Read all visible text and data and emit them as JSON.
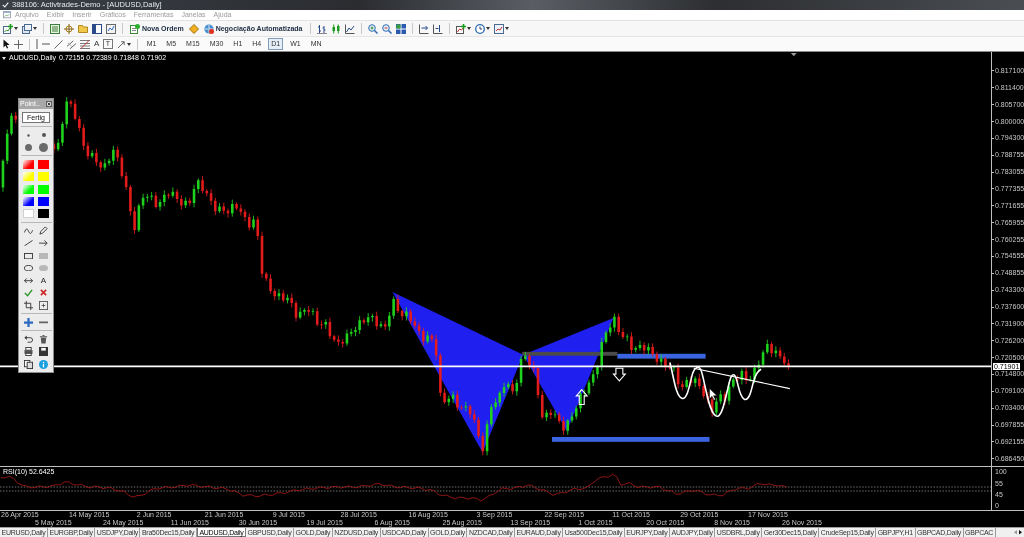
{
  "window": {
    "title": "388106: Activtrades-Demo - [AUDUSD,Daily]"
  },
  "menu": [
    {
      "label": "Arquivo",
      "disabled": true
    },
    {
      "label": "Exibir",
      "disabled": true
    },
    {
      "label": "Inserir",
      "disabled": true
    },
    {
      "label": "Gráficos",
      "disabled": true
    },
    {
      "label": "Ferramentas",
      "disabled": true
    },
    {
      "label": "Janelas",
      "disabled": true
    },
    {
      "label": "Ajuda",
      "disabled": true
    }
  ],
  "toolbar": {
    "buttons": [
      "Nova Ordem",
      "Negociação Automatizada"
    ]
  },
  "drawing_toolbar": {
    "text_tool": "A",
    "label_tool": "T"
  },
  "timeframes": [
    {
      "label": "M1",
      "selected": false
    },
    {
      "label": "M5",
      "selected": false
    },
    {
      "label": "M15",
      "selected": false
    },
    {
      "label": "M30",
      "selected": false
    },
    {
      "label": "H1",
      "selected": false
    },
    {
      "label": "H4",
      "selected": false
    },
    {
      "label": "D1",
      "selected": true
    },
    {
      "label": "W1",
      "selected": false
    },
    {
      "label": "MN",
      "selected": false
    }
  ],
  "chart": {
    "symbol": "AUDUSD,Daily",
    "prices": "0.72155 0.72389 0.71848 0.71902",
    "price_axis": [
      "0.817100",
      "0.811400",
      "0.805700",
      "0.800000",
      "0.794300",
      "0.788755",
      "0.783055",
      "0.777355",
      "0.771655",
      "0.765955",
      "0.760255",
      "0.754555",
      "0.748855",
      "0.743300",
      "0.737600",
      "0.731900",
      "0.726200",
      "0.720500",
      "0.714800",
      "0.709100",
      "0.703400",
      "0.697855",
      "0.692155",
      "0.686450"
    ],
    "current_price": "0.71901"
  },
  "palette": {
    "title": "Point..",
    "button": "Fertig",
    "swatches": [
      {
        "kind": "gradient",
        "color": "#ff0000"
      },
      {
        "kind": "solid",
        "color": "#ff0000"
      },
      {
        "kind": "gradient",
        "color": "#ffff00"
      },
      {
        "kind": "solid",
        "color": "#ffff00"
      },
      {
        "kind": "gradient",
        "color": "#00ff00"
      },
      {
        "kind": "solid",
        "color": "#00ff00"
      },
      {
        "kind": "gradient",
        "color": "#0000ff"
      },
      {
        "kind": "solid",
        "color": "#0000ff"
      },
      {
        "kind": "solid",
        "color": "#ffffff"
      },
      {
        "kind": "solid",
        "color": "#000000"
      }
    ],
    "text_tool": "A"
  },
  "rsi": {
    "label": "RSI(10) 52.6425",
    "axis": [
      "100",
      "55",
      "45",
      "0"
    ]
  },
  "time_axis": [
    "26 Apr 2015",
    "5 May 2015",
    "14 May 2015",
    "24 May 2015",
    "2 Jun 2015",
    "11 Jun 2015",
    "21 Jun 2015",
    "30 Jun 2015",
    "9 Jul 2015",
    "19 Jul 2015",
    "28 Jul 2015",
    "6 Aug 2015",
    "16 Aug 2015",
    "25 Aug 2015",
    "3 Sep 2015",
    "13 Sep 2015",
    "22 Sep 2015",
    "1 Oct 2015",
    "11 Oct 2015",
    "20 Oct 2015",
    "29 Oct 2015",
    "8 Nov 2015",
    "17 Nov 2015",
    "26 Nov 2015"
  ],
  "chart_tabs": [
    {
      "label": "EURUSD,Daily",
      "selected": false
    },
    {
      "label": "EURGBP,Daily",
      "selected": false
    },
    {
      "label": "USDJPY,Daily",
      "selected": false
    },
    {
      "label": "Bra50Dec15,Daily",
      "selected": false
    },
    {
      "label": "AUDUSD,Daily",
      "selected": true
    },
    {
      "label": "GBPUSD,Daily",
      "selected": false
    },
    {
      "label": "GOLD,Daily",
      "selected": false
    },
    {
      "label": "NZDUSD,Daily",
      "selected": false
    },
    {
      "label": "USDCAD,Daily",
      "selected": false
    },
    {
      "label": "GOLD,Daily",
      "selected": false
    },
    {
      "label": "NZDCAD,Daily",
      "selected": false
    },
    {
      "label": "EURAUD,Daily",
      "selected": false
    },
    {
      "label": "Usa500Dec15,Daily",
      "selected": false
    },
    {
      "label": "EURJPY,Daily",
      "selected": false
    },
    {
      "label": "AUDJPY,Daily",
      "selected": false
    },
    {
      "label": "USDBRL,Daily",
      "selected": false
    },
    {
      "label": "Ger30Dec15,Daily",
      "selected": false
    },
    {
      "label": "CrudeSep15,Daily",
      "selected": false
    },
    {
      "label": "GBPJPY,H1",
      "selected": false
    },
    {
      "label": "GBPCAD,Daily",
      "selected": false
    },
    {
      "label": "GBPCAC",
      "selected": false
    }
  ]
}
